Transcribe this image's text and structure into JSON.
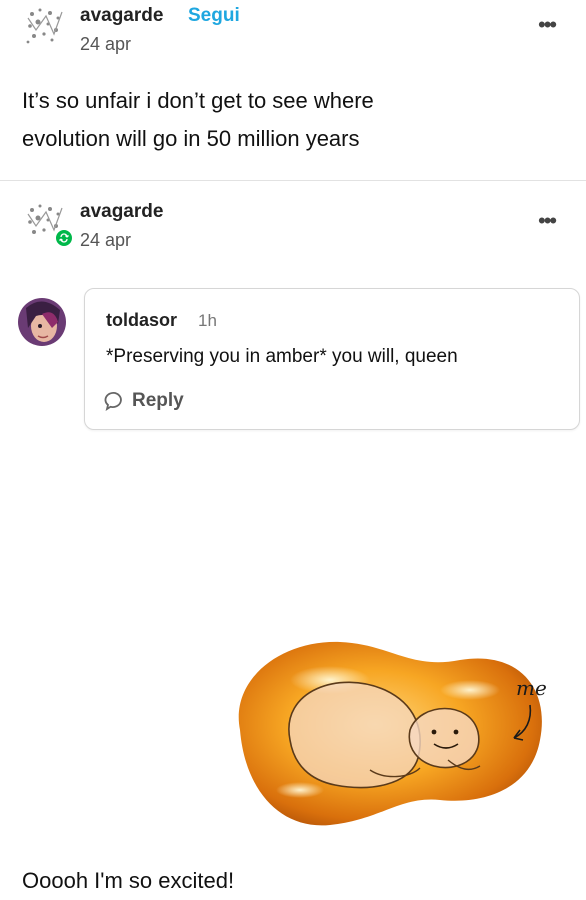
{
  "post": {
    "author": "avagarde",
    "follow_label": "Segui",
    "date": "24 apr",
    "menu_icon": "more-dots-icon",
    "text_line1": "It’s so unfair i don’t get to see where",
    "text_line2": "evolution will go in 50 million years"
  },
  "reblog": {
    "author": "avagarde",
    "date": "24 apr",
    "badge_icon": "reblog-icon",
    "menu_icon": "more-dots-icon"
  },
  "comment": {
    "username": "toldasor",
    "time": "1h",
    "text": "*Preserving you in amber* you will, queen",
    "reply_label": "Reply",
    "reply_icon": "speech-bubble-icon"
  },
  "image": {
    "annotation": "me"
  },
  "caption": "Ooooh I'm so excited!",
  "colors": {
    "follow": "#1fa7e0",
    "reblog_badge": "#00b84a",
    "amber": "#f59a1a"
  }
}
